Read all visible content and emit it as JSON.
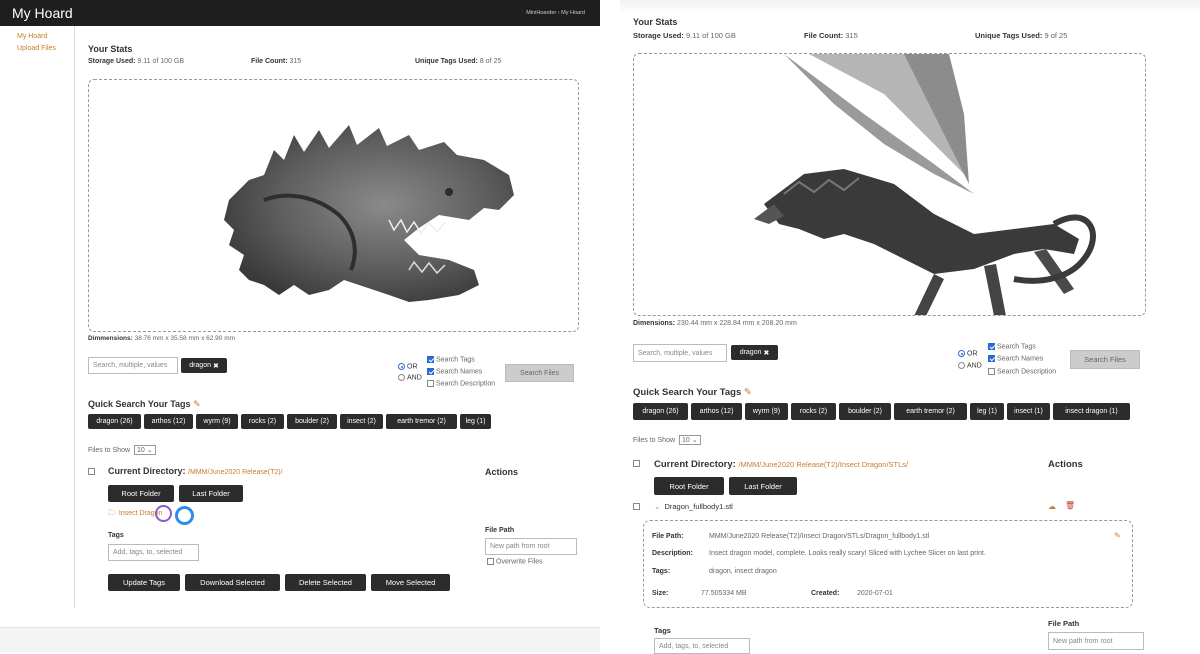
{
  "left": {
    "app_title": "My Hoard",
    "breadcrumb": {
      "root": "MiniHoarder",
      "sep": "›",
      "current": "My Hoard"
    },
    "sidebar": [
      {
        "label": "My Hoard"
      },
      {
        "label": "Upload Files"
      }
    ],
    "stats": {
      "heading": "Your Stats",
      "storage_label": "Storage Used:",
      "storage_value": "9.11 of 100 GB",
      "filecount_label": "File Count:",
      "filecount_value": "315",
      "tags_label": "Unique Tags Used:",
      "tags_value": "8 of 25"
    },
    "dimensions_label": "Dimmensions:",
    "dimensions_value": "38.76 mm x 35.58 mm x 62.90 mm",
    "search": {
      "placeholder": "Search, multiple, values",
      "chip": "dragon",
      "chip_close": "✖",
      "or_label": "OR",
      "and_label": "AND",
      "search_tags": "Search Tags",
      "search_names": "Search Names",
      "search_description": "Search Description",
      "button": "Search Files"
    },
    "quick": {
      "heading": "Quick Search Your Tags",
      "tags": [
        "dragon (26)",
        "arthos (12)",
        "wyrm (9)",
        "rocks (2)",
        "boulder (2)",
        "insect (2)",
        "earth tremor (2)",
        "leg (1)"
      ]
    },
    "files_to_show_label": "Files to Show",
    "files_to_show_value": "10",
    "current_dir_label": "Current Directory:",
    "current_dir_value": "/MMM/June2020 Release(T2)/",
    "actions_label": "Actions",
    "root_folder": "Root Folder",
    "last_folder": "Last Folder",
    "folder_name": "Insect Dragon",
    "tags_label": "Tags",
    "tags_placeholder": "Add, tags, to, selected",
    "filepath_label": "File Path",
    "filepath_placeholder": "New path from root",
    "overwrite_label": "Overwrite Files",
    "buttons": {
      "update_tags": "Update Tags",
      "download": "Download Selected",
      "delete": "Delete Selected",
      "move": "Move Selected"
    }
  },
  "right": {
    "stats": {
      "heading": "Your Stats",
      "storage_label": "Storage Used:",
      "storage_value": "9.11 of 100 GB",
      "filecount_label": "File Count:",
      "filecount_value": "315",
      "tags_label": "Unique Tags Used:",
      "tags_value": "9 of 25"
    },
    "dimensions_label": "Dimensions:",
    "dimensions_value": "230.44 mm x 228.84 mm x 208.20 mm",
    "search": {
      "placeholder": "Search, multiple, values",
      "chip": "dragon",
      "chip_close": "✖",
      "or_label": "OR",
      "and_label": "AND",
      "search_tags": "Search Tags",
      "search_names": "Search Names",
      "search_description": "Search Description",
      "button": "Search Files"
    },
    "quick": {
      "heading": "Quick Search Your Tags",
      "tags": [
        "dragon (26)",
        "arthos (12)",
        "wyrm (9)",
        "rocks (2)",
        "boulder (2)",
        "earth tremor (2)",
        "leg (1)",
        "insect (1)",
        "insect dragon (1)"
      ]
    },
    "files_to_show_label": "Files to Show",
    "files_to_show_value": "10",
    "current_dir_label": "Current Directory:",
    "current_dir_value": "/MMM/June2020 Release(T2)/Insect Dragon/STLs/",
    "actions_label": "Actions",
    "root_folder": "Root Folder",
    "last_folder": "Last Folder",
    "file_name": "Dragon_fullbody1.stl",
    "details": {
      "filepath_label": "File Path:",
      "filepath_value": "MMM/June2020 Release(T2)/Insect Dragon/STLs/Dragon_fullbody1.stl",
      "description_label": "Description:",
      "description_value": "Insect dragon model, complete. Looks really scary! Sliced with Lychee Slicer on last print.",
      "tags_label": "Tags:",
      "tags_value": "dragon, insect dragon",
      "size_label": "Size:",
      "size_value": "77.505334 MB",
      "created_label": "Created:",
      "created_value": "2020-07-01"
    },
    "tags_label": "Tags",
    "tags_placeholder": "Add, tags, to, selected",
    "filepath_label": "File Path",
    "filepath_placeholder": "New path from root"
  },
  "colors": {
    "accent": "#c77d2b",
    "dark": "#2c2c2c",
    "header": "#1e1e1e"
  }
}
